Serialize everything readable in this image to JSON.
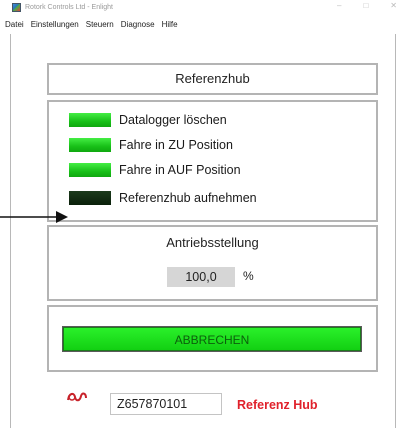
{
  "window": {
    "title": "Rotork Controls Ltd - Enlight",
    "controls": [
      "–",
      "□",
      "✕"
    ]
  },
  "menu": {
    "items": [
      {
        "label": "Datei"
      },
      {
        "label": "Einstellungen"
      },
      {
        "label": "Steuern"
      },
      {
        "label": "Diagnose"
      },
      {
        "label": "Hilfe"
      }
    ]
  },
  "header": {
    "title": "Referenzhub"
  },
  "status": {
    "items": [
      {
        "label": "Datalogger löschen",
        "state": "on"
      },
      {
        "label": "Fahre in ZU Position",
        "state": "on"
      },
      {
        "label": "Fahre in AUF Position",
        "state": "on"
      },
      {
        "label": "Referenzhub aufnehmen",
        "state": "off"
      }
    ]
  },
  "drive": {
    "title": "Antriebsstellung",
    "value": "100,0",
    "unit": "%"
  },
  "abort": {
    "label": "ABBRECHEN"
  },
  "footer": {
    "logo_icon": "rotork-logo-icon",
    "serial": "Z657870101",
    "status": "Referenz Hub"
  },
  "colors": {
    "led_on": "#22dd22",
    "led_off": "#0d250d",
    "abort_button": "#1ee01e",
    "status_red": "#e0212b"
  }
}
